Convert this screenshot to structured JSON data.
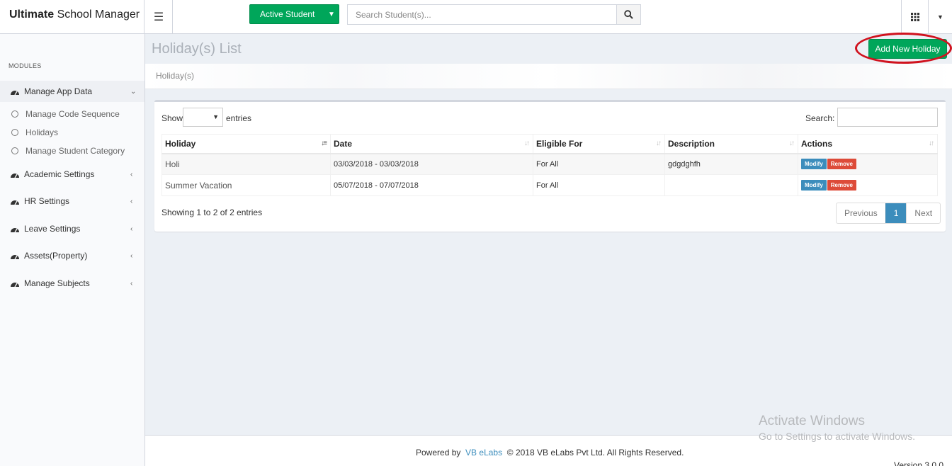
{
  "header": {
    "brand_bold": "Ultimate",
    "brand_rest": " School Manager",
    "active_student_label": "Active Student",
    "search_placeholder": "Search Student(s)..."
  },
  "sidebar": {
    "modules_header": "MODULES",
    "items": [
      {
        "label": "Manage App Data",
        "expanded": true
      },
      {
        "label": "Academic Settings"
      },
      {
        "label": "HR Settings"
      },
      {
        "label": "Leave Settings"
      },
      {
        "label": "Assets(Property)"
      },
      {
        "label": "Manage Subjects"
      }
    ],
    "sub_items": [
      {
        "label": "Manage Code Sequence"
      },
      {
        "label": "Holidays"
      },
      {
        "label": "Manage Student Category"
      }
    ]
  },
  "page": {
    "title": "Holiday(s) List",
    "add_button": "Add New Holiday",
    "breadcrumb": "Holiday(s)"
  },
  "table": {
    "show_label": "Show",
    "entries_label": "entries",
    "search_label": "Search:",
    "columns": [
      "Holiday",
      "Date",
      "Eligible For",
      "Description",
      "Actions"
    ],
    "rows": [
      {
        "holiday": "Holi",
        "date": "03/03/2018 - 03/03/2018",
        "eligible": "For All",
        "description": "gdgdghfh",
        "modify": "Modify",
        "remove": "Remove"
      },
      {
        "holiday": "Summer Vacation",
        "date": "05/07/2018 - 07/07/2018",
        "eligible": "For All",
        "description": "",
        "modify": "Modify",
        "remove": "Remove"
      }
    ],
    "info": "Showing 1 to 2 of 2 entries",
    "pager": {
      "previous": "Previous",
      "current": "1",
      "next": "Next"
    }
  },
  "footer": {
    "powered_by": "Powered by",
    "link": "VB eLabs",
    "rights": "© 2018 VB eLabs Pvt Ltd. All Rights Reserved.",
    "version": "Version 3.0.0"
  },
  "watermark": {
    "line1": "Activate Windows",
    "line2": "Go to Settings to activate Windows."
  },
  "colors": {
    "green": "#00a65a",
    "blue": "#3c8dbc",
    "red": "#dd4b39",
    "annotation": "#d0121e"
  }
}
